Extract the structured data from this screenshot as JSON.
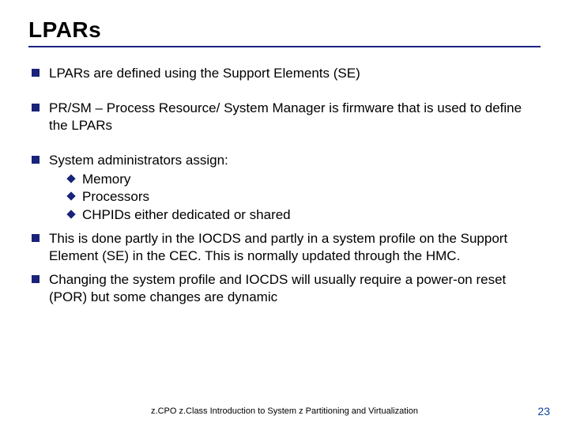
{
  "title": "LPARs",
  "bullets": [
    {
      "text": "LPARs are defined using the Support Elements (SE)"
    },
    {
      "text": "PR/SM – Process Resource/ System Manager is firmware that is used to define the LPARs"
    },
    {
      "text": "System administrators assign:",
      "sub": [
        "Memory",
        "Processors",
        "CHPIDs either dedicated or shared"
      ]
    },
    {
      "text": "This is done partly in the IOCDS and partly in a system profile on the Support Element (SE) in the CEC. This is normally updated through the HMC."
    },
    {
      "text": "Changing the system profile and IOCDS will usually require a power-on reset (POR) but some changes are dynamic"
    }
  ],
  "footer": "z.CPO z.Class  Introduction to System z Partitioning and Virtualization",
  "page": "23"
}
